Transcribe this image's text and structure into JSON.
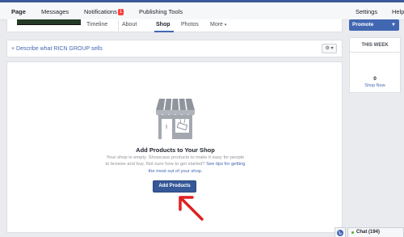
{
  "admin_bar": {
    "page": "Page",
    "messages": "Messages",
    "notifications": "Notifications",
    "notifications_badge": "1",
    "publishing_tools": "Publishing Tools",
    "settings": "Settings",
    "help": "Help"
  },
  "page_tabs": [
    "Timeline",
    "About",
    "Shop",
    "Photos",
    "More"
  ],
  "describe_link": "+ Describe what RICN GROUP sells",
  "empty_state": {
    "title": "Add Products to Your Shop",
    "description": "Your shop is empty. Showcase products to make it easy for people to browse and buy. Not sure how to get started?",
    "help_link": "See tips for getting the most out of your shop.",
    "button": "Add Products"
  },
  "right_column": {
    "promote": "Promote",
    "this_week": "THIS WEEK",
    "shop_now_count": "0",
    "shop_now_label": "Shop Now"
  },
  "chat": "Chat (194)",
  "colors": {
    "brand_blue": "#3b5998",
    "link_blue": "#4267b2",
    "arrow_red": "#e02020"
  }
}
